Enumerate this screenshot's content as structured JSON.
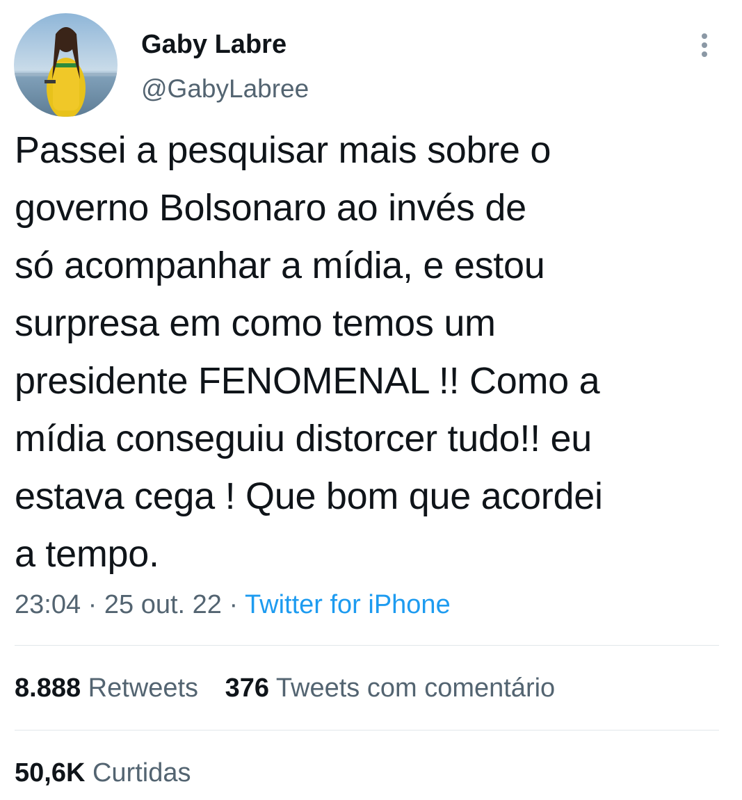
{
  "author": {
    "display_name": "Gaby Labre",
    "handle": "@GabyLabree"
  },
  "tweet": {
    "text": "Passei a pesquisar mais sobre o\ngoverno Bolsonaro ao invés de\nsó acompanhar a mídia, e estou\nsurpresa em como temos um\npresidente FENOMENAL !! Como a\nmídia conseguiu distorcer tudo!! eu\nestava cega ! Que bom que acordei\na tempo.",
    "time": "23:04",
    "separator": "·",
    "date": "25 out. 22",
    "source": "Twitter for iPhone"
  },
  "stats": {
    "retweets_count": "8.888",
    "retweets_label": "Retweets",
    "quotes_count": "376",
    "quotes_label": "Tweets com comentário",
    "likes_count": "50,6K",
    "likes_label": "Curtidas"
  },
  "icons": {
    "more": "more-vertical-icon"
  },
  "colors": {
    "text_primary": "#0f1419",
    "text_secondary": "#536471",
    "link": "#1d9bf0",
    "divider": "#e1e6ea"
  }
}
